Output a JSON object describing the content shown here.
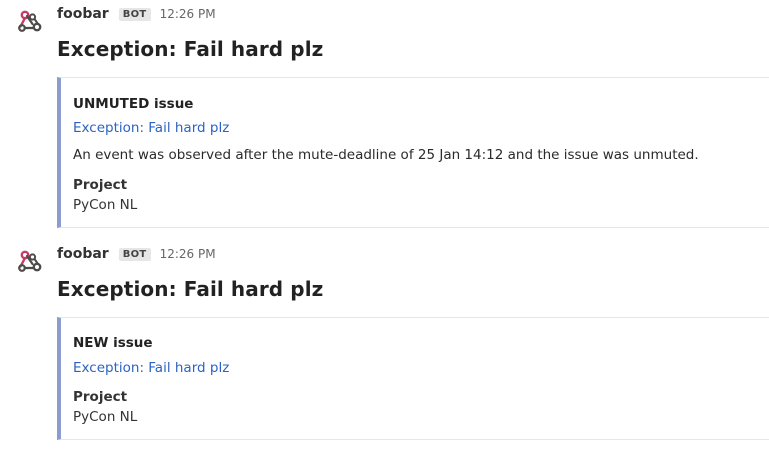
{
  "messages": [
    {
      "author": "foobar",
      "badge": "BOT",
      "timestamp": "12:26 PM",
      "title": "Exception: Fail hard plz",
      "attachment": {
        "heading": "UNMUTED issue",
        "link": "Exception: Fail hard plz",
        "description": "An event was observed after the mute-deadline of 25 Jan 14:12 and the issue was unmuted.",
        "field_title": "Project",
        "field_value": "PyCon NL"
      },
      "accent_color": "#8b9ccf"
    },
    {
      "author": "foobar",
      "badge": "BOT",
      "timestamp": "12:26 PM",
      "title": "Exception: Fail hard plz",
      "attachment": {
        "heading": "NEW issue",
        "link": "Exception: Fail hard plz",
        "field_title": "Project",
        "field_value": "PyCon NL"
      },
      "accent_color": "#8b9ccf"
    }
  ],
  "avatar_icon": "webhook-icon",
  "colors": {
    "link": "#2b63c4",
    "accent_bar": "#8b9ccf",
    "badge_bg": "#e6e6e6",
    "avatar_red": "#c73a63",
    "avatar_dark": "#4b4b4b"
  }
}
